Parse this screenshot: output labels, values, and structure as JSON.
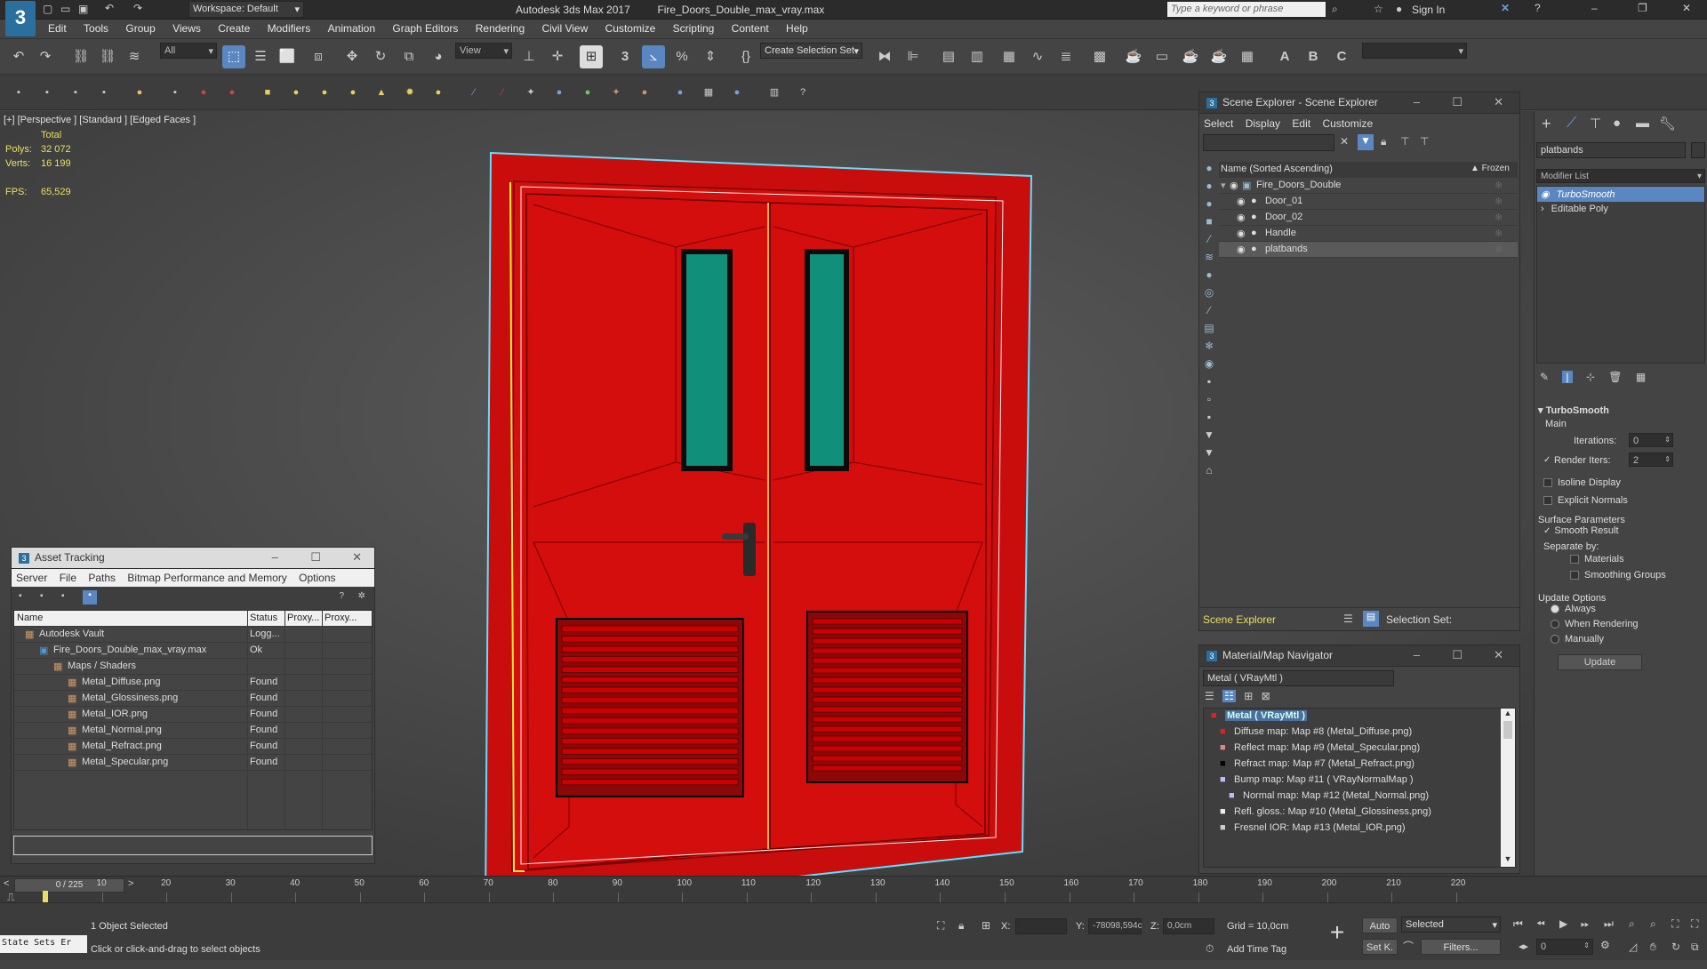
{
  "app": {
    "title": "Autodesk 3ds Max 2017",
    "file": "Fire_Doors_Double_max_vray.max",
    "workspace": "Workspace: Default",
    "search_placeholder": "Type a keyword or phrase",
    "sign_in": "Sign In"
  },
  "menu": [
    "Edit",
    "Tools",
    "Group",
    "Views",
    "Create",
    "Modifiers",
    "Animation",
    "Graph Editors",
    "Rendering",
    "Civil View",
    "Customize",
    "Scripting",
    "Content",
    "Help"
  ],
  "toolbar": {
    "filter": "All",
    "view": "View",
    "selection_set": "Create Selection Set"
  },
  "viewport": {
    "label": "[+] [Perspective ] [Standard ] [Edged Faces ]",
    "stats_total": "Total",
    "polys_label": "Polys:",
    "polys": "32 072",
    "verts_label": "Verts:",
    "verts": "16 199",
    "fps_label": "FPS:",
    "fps": "65,529"
  },
  "colors": {
    "door": "#d40d0d",
    "glass": "#10907a",
    "accent": "#5a87c2"
  },
  "scene_explorer": {
    "title": "Scene Explorer - Scene Explorer",
    "menu": [
      "Select",
      "Display",
      "Edit",
      "Customize"
    ],
    "col_name": "Name (Sorted Ascending)",
    "col_frozen": "▲ Frozen",
    "items": [
      "Fire_Doors_Double",
      "Door_01",
      "Door_02",
      "Handle",
      "platbands"
    ],
    "footer_left": "Scene Explorer",
    "footer_right": "Selection Set:"
  },
  "asset_tracking": {
    "title": "Asset Tracking",
    "menu": [
      "Server",
      "File",
      "Paths",
      "Bitmap Performance and Memory",
      "Options"
    ],
    "columns": [
      "Name",
      "Status",
      "Proxy...",
      "Proxy..."
    ],
    "rows": [
      {
        "name": "Autodesk Vault",
        "status": "Logg..."
      },
      {
        "name": "Fire_Doors_Double_max_vray.max",
        "status": "Ok"
      },
      {
        "name": "Maps / Shaders",
        "status": ""
      },
      {
        "name": "Metal_Diffuse.png",
        "status": "Found"
      },
      {
        "name": "Metal_Glossiness.png",
        "status": "Found"
      },
      {
        "name": "Metal_IOR.png",
        "status": "Found"
      },
      {
        "name": "Metal_Normal.png",
        "status": "Found"
      },
      {
        "name": "Metal_Refract.png",
        "status": "Found"
      },
      {
        "name": "Metal_Specular.png",
        "status": "Found"
      }
    ]
  },
  "material_navigator": {
    "title": "Material/Map Navigator",
    "current": "Metal  ( VRayMtl )",
    "root": "Metal  ( VRayMtl )",
    "maps": [
      "Diffuse map: Map #8 (Metal_Diffuse.png)",
      "Reflect map: Map #9 (Metal_Specular.png)",
      "Refract map: Map #7 (Metal_Refract.png)",
      "Bump map: Map #11  ( VRayNormalMap )",
      "Normal map: Map #12 (Metal_Normal.png)",
      "Refl. gloss.: Map #10 (Metal_Glossiness.png)",
      "Fresnel IOR: Map #13 (Metal_IOR.png)"
    ]
  },
  "command_panel": {
    "object_name": "platbands",
    "modifier_list": "Modifier List",
    "stack": [
      "TurboSmooth",
      "Editable Poly"
    ],
    "rollout": "TurboSmooth",
    "main": "Main",
    "iterations_label": "Iterations:",
    "iterations": "0",
    "render_iters_label": "Render Iters:",
    "render_iters": "2",
    "isoline": "Isoline Display",
    "explicit": "Explicit Normals",
    "surface": "Surface Parameters",
    "smooth": "Smooth Result",
    "separate": "Separate by:",
    "materials": "Materials",
    "smoothing": "Smoothing Groups",
    "update_options": "Update Options",
    "always": "Always",
    "when_rendering": "When Rendering",
    "manually": "Manually",
    "update": "Update"
  },
  "timeline": {
    "frame": "0 / 225",
    "ticks": [
      "10",
      "20",
      "30",
      "40",
      "50",
      "60",
      "70",
      "80",
      "90",
      "100",
      "110",
      "120",
      "130",
      "140",
      "150",
      "160",
      "170",
      "180",
      "190",
      "200",
      "210",
      "220"
    ]
  },
  "status": {
    "state_sets": "State Sets Er",
    "selected": "1 Object Selected",
    "prompt": "Click or click-and-drag to select objects",
    "x_label": "X:",
    "y_label": "Y:",
    "y_value": "-78098,594c",
    "z_label": "Z:",
    "z_value": "0,0cm",
    "grid": "Grid = 10,0cm",
    "add_time_tag": "Add Time Tag",
    "auto": "Auto",
    "selected_mode": "Selected",
    "set_k": "Set K.",
    "filters": "Filters...",
    "frame_field": "0"
  }
}
